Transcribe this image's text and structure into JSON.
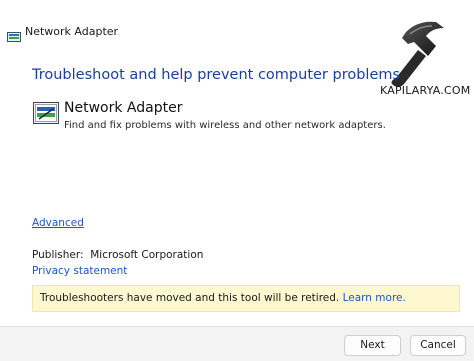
{
  "window": {
    "title": "Network Adapter"
  },
  "watermark": {
    "brand": "KAPILARYA.COM",
    "icon": "hammer-logo-icon"
  },
  "main": {
    "headline": "Troubleshoot and help prevent computer problems",
    "item": {
      "icon": "network-adapter-icon",
      "title": "Network Adapter",
      "description": "Find and fix problems with wireless and other network adapters."
    },
    "advanced_link": "Advanced",
    "publisher_label": "Publisher:",
    "publisher_value": "Microsoft Corporation",
    "privacy_link": "Privacy statement",
    "notice": {
      "text": "Troubleshooters have moved and this tool will be retired.",
      "link": "Learn more."
    }
  },
  "footer": {
    "next_label": "Next",
    "cancel_label": "Cancel"
  },
  "colors": {
    "headline": "#1a3f9a",
    "link": "#1f55c4",
    "notice_bg": "#fdf8cf"
  }
}
